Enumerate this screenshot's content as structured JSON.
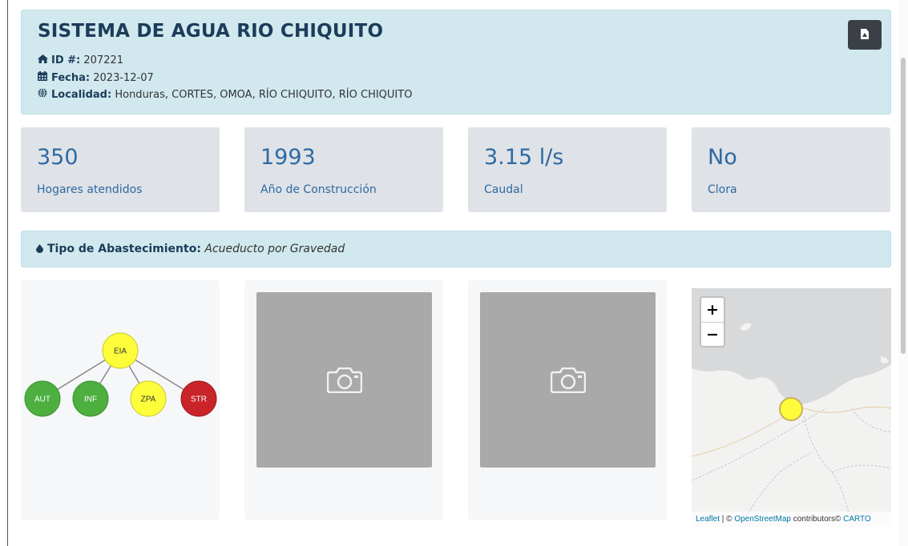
{
  "header": {
    "title": "SISTEMA DE AGUA RIO CHIQUITO",
    "id_label": "ID #:",
    "id_value": "207221",
    "date_label": "Fecha:",
    "date_value": "2023-12-07",
    "location_label": "Localidad:",
    "location_value": "Honduras, CORTES, OMOA, RÍO CHIQUITO, RÍO CHIQUITO",
    "pdf_icon": "file-pdf-icon"
  },
  "stats": [
    {
      "value": "350",
      "label": "Hogares atendidos"
    },
    {
      "value": "1993",
      "label": "Año de Construcción"
    },
    {
      "value": "3.15 l/s",
      "label": "Caudal"
    },
    {
      "value": "No",
      "label": "Clora"
    }
  ],
  "supply": {
    "label": "Tipo de Abastecimiento:",
    "value": "Acueducto por Gravedad"
  },
  "diagram": {
    "root": {
      "label": "EIA",
      "status": "yellow"
    },
    "children": [
      {
        "label": "AUT",
        "status": "green"
      },
      {
        "label": "INF",
        "status": "green"
      },
      {
        "label": "ZPA",
        "status": "yellow"
      },
      {
        "label": "STR",
        "status": "red"
      }
    ],
    "colors": {
      "green": "#4caf3e",
      "yellow": "#fdfd3c",
      "red": "#c8242a"
    }
  },
  "photos": [
    {
      "icon": "camera-icon"
    },
    {
      "icon": "camera-icon"
    }
  ],
  "map": {
    "zoom_in": "+",
    "zoom_out": "−",
    "attr_leaflet": "Leaflet",
    "attr_sep": " | © ",
    "attr_osm": "OpenStreetMap",
    "attr_contrib": " contributors© ",
    "attr_carto": "CARTO",
    "marker_color": "#fdfd3c"
  }
}
